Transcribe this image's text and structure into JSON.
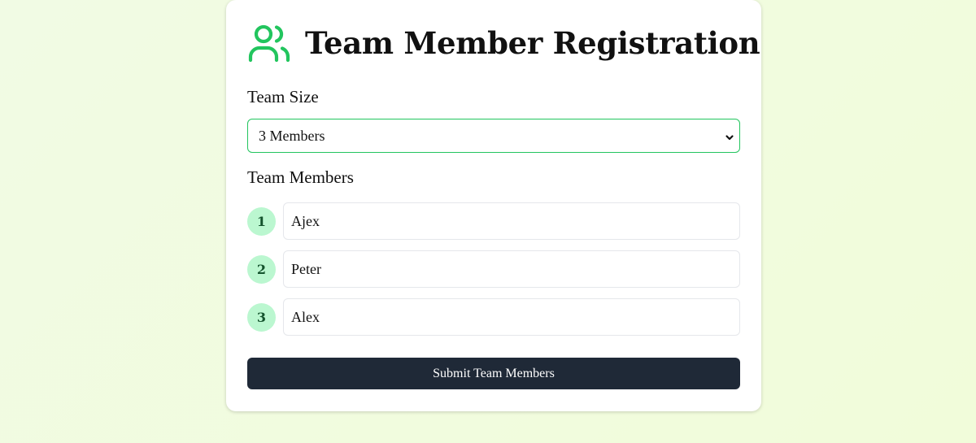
{
  "header": {
    "title": "Team Member Registration",
    "icon": "users-icon",
    "icon_color": "#22c55e"
  },
  "team_size": {
    "label": "Team Size",
    "selected": "3 Members"
  },
  "team_members": {
    "label": "Team Members",
    "members": [
      {
        "number": "1",
        "name": "Ajex"
      },
      {
        "number": "2",
        "name": "Peter"
      },
      {
        "number": "3",
        "name": "Alex"
      }
    ]
  },
  "submit": {
    "label": "Submit Team Members"
  },
  "colors": {
    "accent": "#22c55e",
    "badge_bg": "#bbf7d0",
    "button_bg": "#1f2937"
  }
}
